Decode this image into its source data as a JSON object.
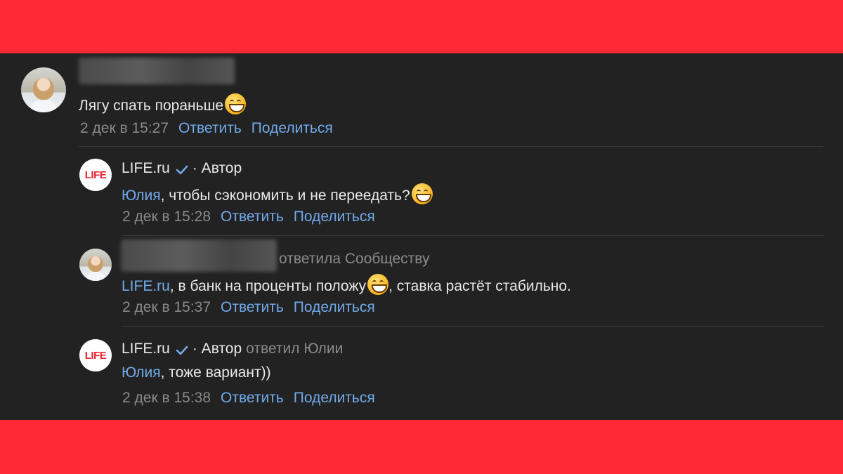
{
  "colors": {
    "brand_red": "#ff2a35",
    "panel_bg": "#222222",
    "link_blue": "#71aaeb",
    "meta_gray": "#8a8a8a",
    "text": "#e9e9e9"
  },
  "comments": [
    {
      "text": "Лягу спать пораньше",
      "emoji": "grinning-face-emoji",
      "time": "2 дек в 15:27",
      "reply": "Ответить",
      "share": "Поделиться"
    },
    {
      "author": "LIFE.ru",
      "role": "· Автор",
      "avatar_text": "LIFE",
      "mention": "Юлия",
      "text": ", чтобы сэкономить и не переедать?",
      "emoji": "grinning-face-emoji",
      "time": "2 дек в 15:28",
      "reply": "Ответить",
      "share": "Поделиться"
    },
    {
      "replied_to": "ответила Сообществу",
      "mention": "LIFE.ru",
      "text_before": ", в банк на проценты положу",
      "text_after": ", ставка растёт стабильно.",
      "emoji": "grinning-face-emoji",
      "time": "2 дек в 15:37",
      "reply": "Ответить",
      "share": "Поделиться"
    },
    {
      "author": "LIFE.ru",
      "role": "· Автор",
      "replied_to": "ответил Юлии",
      "avatar_text": "LIFE",
      "mention": "Юлия",
      "text": ", тоже вариант))",
      "time": "2 дек в 15:38",
      "reply": "Ответить",
      "share": "Поделиться"
    }
  ]
}
